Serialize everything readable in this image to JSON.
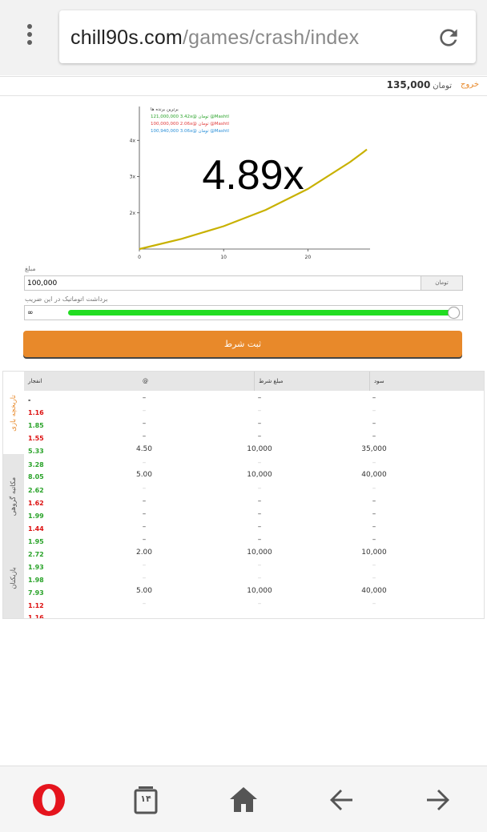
{
  "browser": {
    "url_domain": "chill90s.com",
    "url_path": "/games/crash/index",
    "tab_count": "۱۴"
  },
  "header": {
    "logout_label": "خروج",
    "balance_value": "135,000",
    "balance_currency": "تومان"
  },
  "game": {
    "multiplier": "4.89x",
    "winners_title": "برترین برنده ها",
    "winners": [
      {
        "text": "121,000,000 3.42x@ تومان @Mashtl",
        "color": "#2aa32a"
      },
      {
        "text": "100,000,000 2.06x@ تومان @Mashtl",
        "color": "#e03a3a"
      },
      {
        "text": "100,940,000 3.06x@ تومان @Mashtl",
        "color": "#2a8fd8"
      }
    ]
  },
  "chart_data": {
    "type": "line",
    "series": [
      {
        "values": [
          [
            0,
            1.0
          ],
          [
            5,
            1.28
          ],
          [
            10,
            1.63
          ],
          [
            15,
            2.08
          ],
          [
            20,
            2.66
          ],
          [
            25,
            3.4
          ],
          [
            26.5,
            3.66
          ],
          [
            27,
            3.75
          ]
        ]
      }
    ],
    "x_ticks": [
      "0",
      "10",
      "20"
    ],
    "y_ticks": [
      "2x",
      "3x",
      "4x"
    ],
    "xlim": [
      0,
      27
    ],
    "ylim": [
      1,
      4.89
    ],
    "line_color": "#c8b100",
    "grid": false
  },
  "form": {
    "amount_label": "مبلغ",
    "amount_value": "100,000",
    "amount_currency": "تومان",
    "auto_label": "برداشت اتوماتیک در این ضریب",
    "auto_value": "∞",
    "auto_level": 1.0,
    "submit_label": "ثبت شرط",
    "accent_color": "#e8892a",
    "slider_color": "#22dd22"
  },
  "history": {
    "tabs": [
      "تاریخچه بازی",
      "مکاتبه گروهی",
      "بازیکنان"
    ],
    "columns": {
      "crash": "انفجار",
      "at": "@",
      "bet": "مبلغ شرط",
      "profit": "سود"
    },
    "rows": [
      {
        "crash": "-",
        "color": "black",
        "at": "–",
        "bet": "–",
        "profit": "–",
        "faint": false
      },
      {
        "crash": "1.16",
        "color": "red",
        "at": "–",
        "bet": "–",
        "profit": "–",
        "faint": true
      },
      {
        "crash": "1.85",
        "color": "green",
        "at": "–",
        "bet": "–",
        "profit": "–",
        "faint": false
      },
      {
        "crash": "1.55",
        "color": "red",
        "at": "–",
        "bet": "–",
        "profit": "–",
        "faint": false
      },
      {
        "crash": "5.33",
        "color": "green",
        "at": "4.50",
        "bet": "10,000",
        "profit": "35,000",
        "faint": false
      },
      {
        "crash": "3.28",
        "color": "green",
        "at": "–",
        "bet": "–",
        "profit": "–",
        "faint": true
      },
      {
        "crash": "8.05",
        "color": "green",
        "at": "5.00",
        "bet": "10,000",
        "profit": "40,000",
        "faint": false
      },
      {
        "crash": "2.62",
        "color": "green",
        "at": "–",
        "bet": "–",
        "profit": "–",
        "faint": true
      },
      {
        "crash": "1.62",
        "color": "red",
        "at": "–",
        "bet": "–",
        "profit": "–",
        "faint": false
      },
      {
        "crash": "1.99",
        "color": "green",
        "at": "–",
        "bet": "–",
        "profit": "–",
        "faint": false
      },
      {
        "crash": "1.44",
        "color": "red",
        "at": "–",
        "bet": "–",
        "profit": "–",
        "faint": false
      },
      {
        "crash": "1.95",
        "color": "green",
        "at": "–",
        "bet": "–",
        "profit": "–",
        "faint": false
      },
      {
        "crash": "2.72",
        "color": "green",
        "at": "2.00",
        "bet": "10,000",
        "profit": "10,000",
        "faint": false
      },
      {
        "crash": "1.93",
        "color": "green",
        "at": "–",
        "bet": "–",
        "profit": "–",
        "faint": true
      },
      {
        "crash": "1.98",
        "color": "green",
        "at": "–",
        "bet": "–",
        "profit": "–",
        "faint": true
      },
      {
        "crash": "7.93",
        "color": "green",
        "at": "5.00",
        "bet": "10,000",
        "profit": "40,000",
        "faint": false
      },
      {
        "crash": "1.12",
        "color": "red",
        "at": "–",
        "bet": "–",
        "profit": "–",
        "faint": true
      },
      {
        "crash": "1.16",
        "color": "red",
        "at": "",
        "bet": "",
        "profit": "",
        "faint": true
      }
    ]
  },
  "bottom_nav": {
    "items": [
      "opera-logo-icon",
      "tabs-icon",
      "home-icon",
      "back-arrow-icon",
      "forward-arrow-icon"
    ]
  }
}
